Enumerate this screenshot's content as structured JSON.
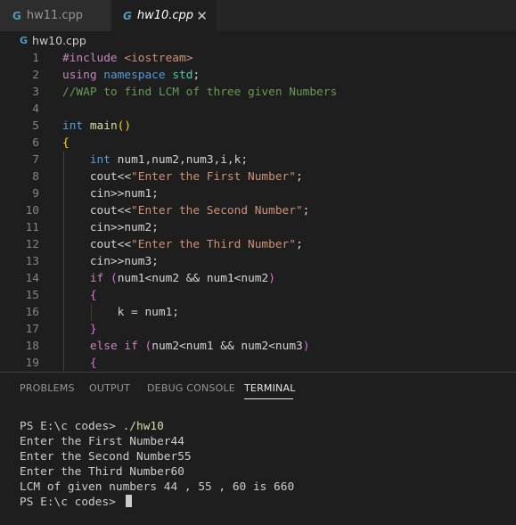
{
  "tabs": [
    {
      "icon": "cpp-icon",
      "label": "hw11.cpp",
      "active": false
    },
    {
      "icon": "cpp-icon",
      "label": "hw10.cpp",
      "active": true,
      "close": "✕"
    }
  ],
  "breadcrumb": {
    "icon": "cpp-icon",
    "file": "hw10.cpp"
  },
  "code_lines": [
    {
      "n": "1",
      "text": "#include <iostream>"
    },
    {
      "n": "2",
      "text": "using namespace std;"
    },
    {
      "n": "3",
      "text": "//WAP to find LCM of three given Numbers"
    },
    {
      "n": "4",
      "text": ""
    },
    {
      "n": "5",
      "text": "int main()"
    },
    {
      "n": "6",
      "text": "{"
    },
    {
      "n": "7",
      "text": "    int num1,num2,num3,i,k;"
    },
    {
      "n": "8",
      "text": "    cout<<\"Enter the First Number\";"
    },
    {
      "n": "9",
      "text": "    cin>>num1;"
    },
    {
      "n": "10",
      "text": "    cout<<\"Enter the Second Number\";"
    },
    {
      "n": "11",
      "text": "    cin>>num2;"
    },
    {
      "n": "12",
      "text": "    cout<<\"Enter the Third Number\";"
    },
    {
      "n": "13",
      "text": "    cin>>num3;"
    },
    {
      "n": "14",
      "text": "    if (num1<num2 && num1<num2)"
    },
    {
      "n": "15",
      "text": "    {"
    },
    {
      "n": "16",
      "text": "        k = num1;"
    },
    {
      "n": "17",
      "text": "    }"
    },
    {
      "n": "18",
      "text": "    else if (num2<num1 && num2<num3)"
    },
    {
      "n": "19",
      "text": "    {"
    }
  ],
  "panel": {
    "tabs": [
      "PROBLEMS",
      "OUTPUT",
      "DEBUG CONSOLE",
      "TERMINAL"
    ],
    "active_tab": "TERMINAL"
  },
  "terminal": {
    "lines": [
      {
        "prompt": "PS E:\\c codes> ",
        "cmd": "./hw10"
      },
      {
        "text": "Enter the First Number44"
      },
      {
        "text": "Enter the Second Number55"
      },
      {
        "text": "Enter the Third Number60"
      },
      {
        "text": "LCM of given numbers 44 , 55 , 60 is 660"
      },
      {
        "prompt": "PS E:\\c codes> ",
        "cmd": "",
        "cursor": true
      }
    ]
  },
  "colors": {
    "background": "#1e1e1e",
    "tabbar": "#252526",
    "cpp_icon": "#519aba",
    "keyword": "#569cd6",
    "string": "#ce9178",
    "comment": "#6a9955"
  }
}
